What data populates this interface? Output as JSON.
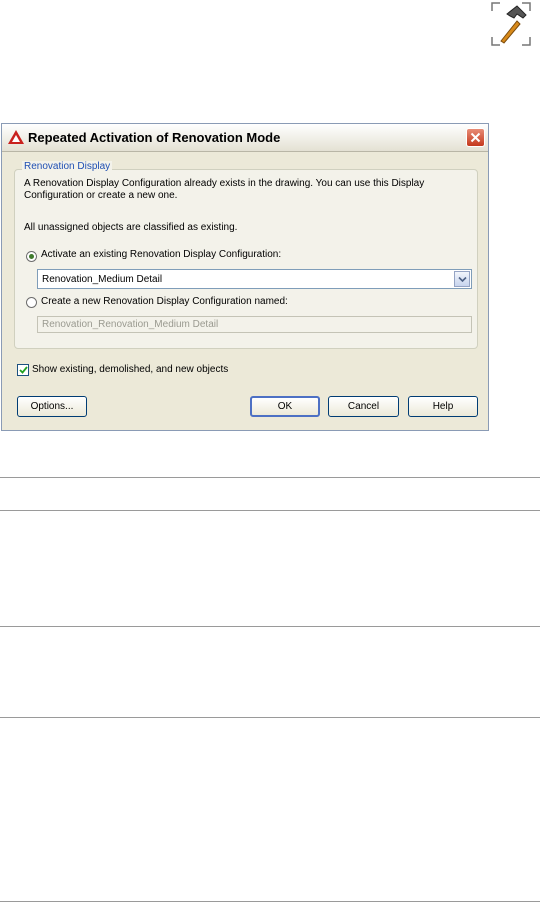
{
  "dialog": {
    "title": "Repeated Activation of Renovation Mode",
    "group_label": "Renovation Display",
    "description_line1": "A Renovation Display Configuration already exists in the drawing. You can use this Display",
    "description_line2": "Configuration or create a new one.",
    "info": "All unassigned objects are classified as existing.",
    "option_existing": {
      "label": "Activate an existing Renovation Display Configuration:",
      "selected": true
    },
    "existing_select": {
      "value": "Renovation_Medium Detail"
    },
    "option_new": {
      "label": "Create a new Renovation Display Configuration named:",
      "selected": false
    },
    "new_name_input": {
      "value": "Renovation_Renovation_Medium Detail"
    },
    "show_objects": {
      "label": "Show existing, demolished, and new objects",
      "checked": true
    },
    "buttons": {
      "options": "Options...",
      "ok": "OK",
      "cancel": "Cancel",
      "help": "Help"
    }
  },
  "icons": {
    "tool": "hammer-icon",
    "app": "autocad-logo-icon",
    "close": "close-icon",
    "dropdown": "chevron-down-icon",
    "check": "checkmark-icon"
  },
  "colors": {
    "dialog_background": "#ece9d8",
    "group_label": "#1f4fb3",
    "close_button": "#c4391d",
    "default_button_border": "#4d70c4"
  }
}
